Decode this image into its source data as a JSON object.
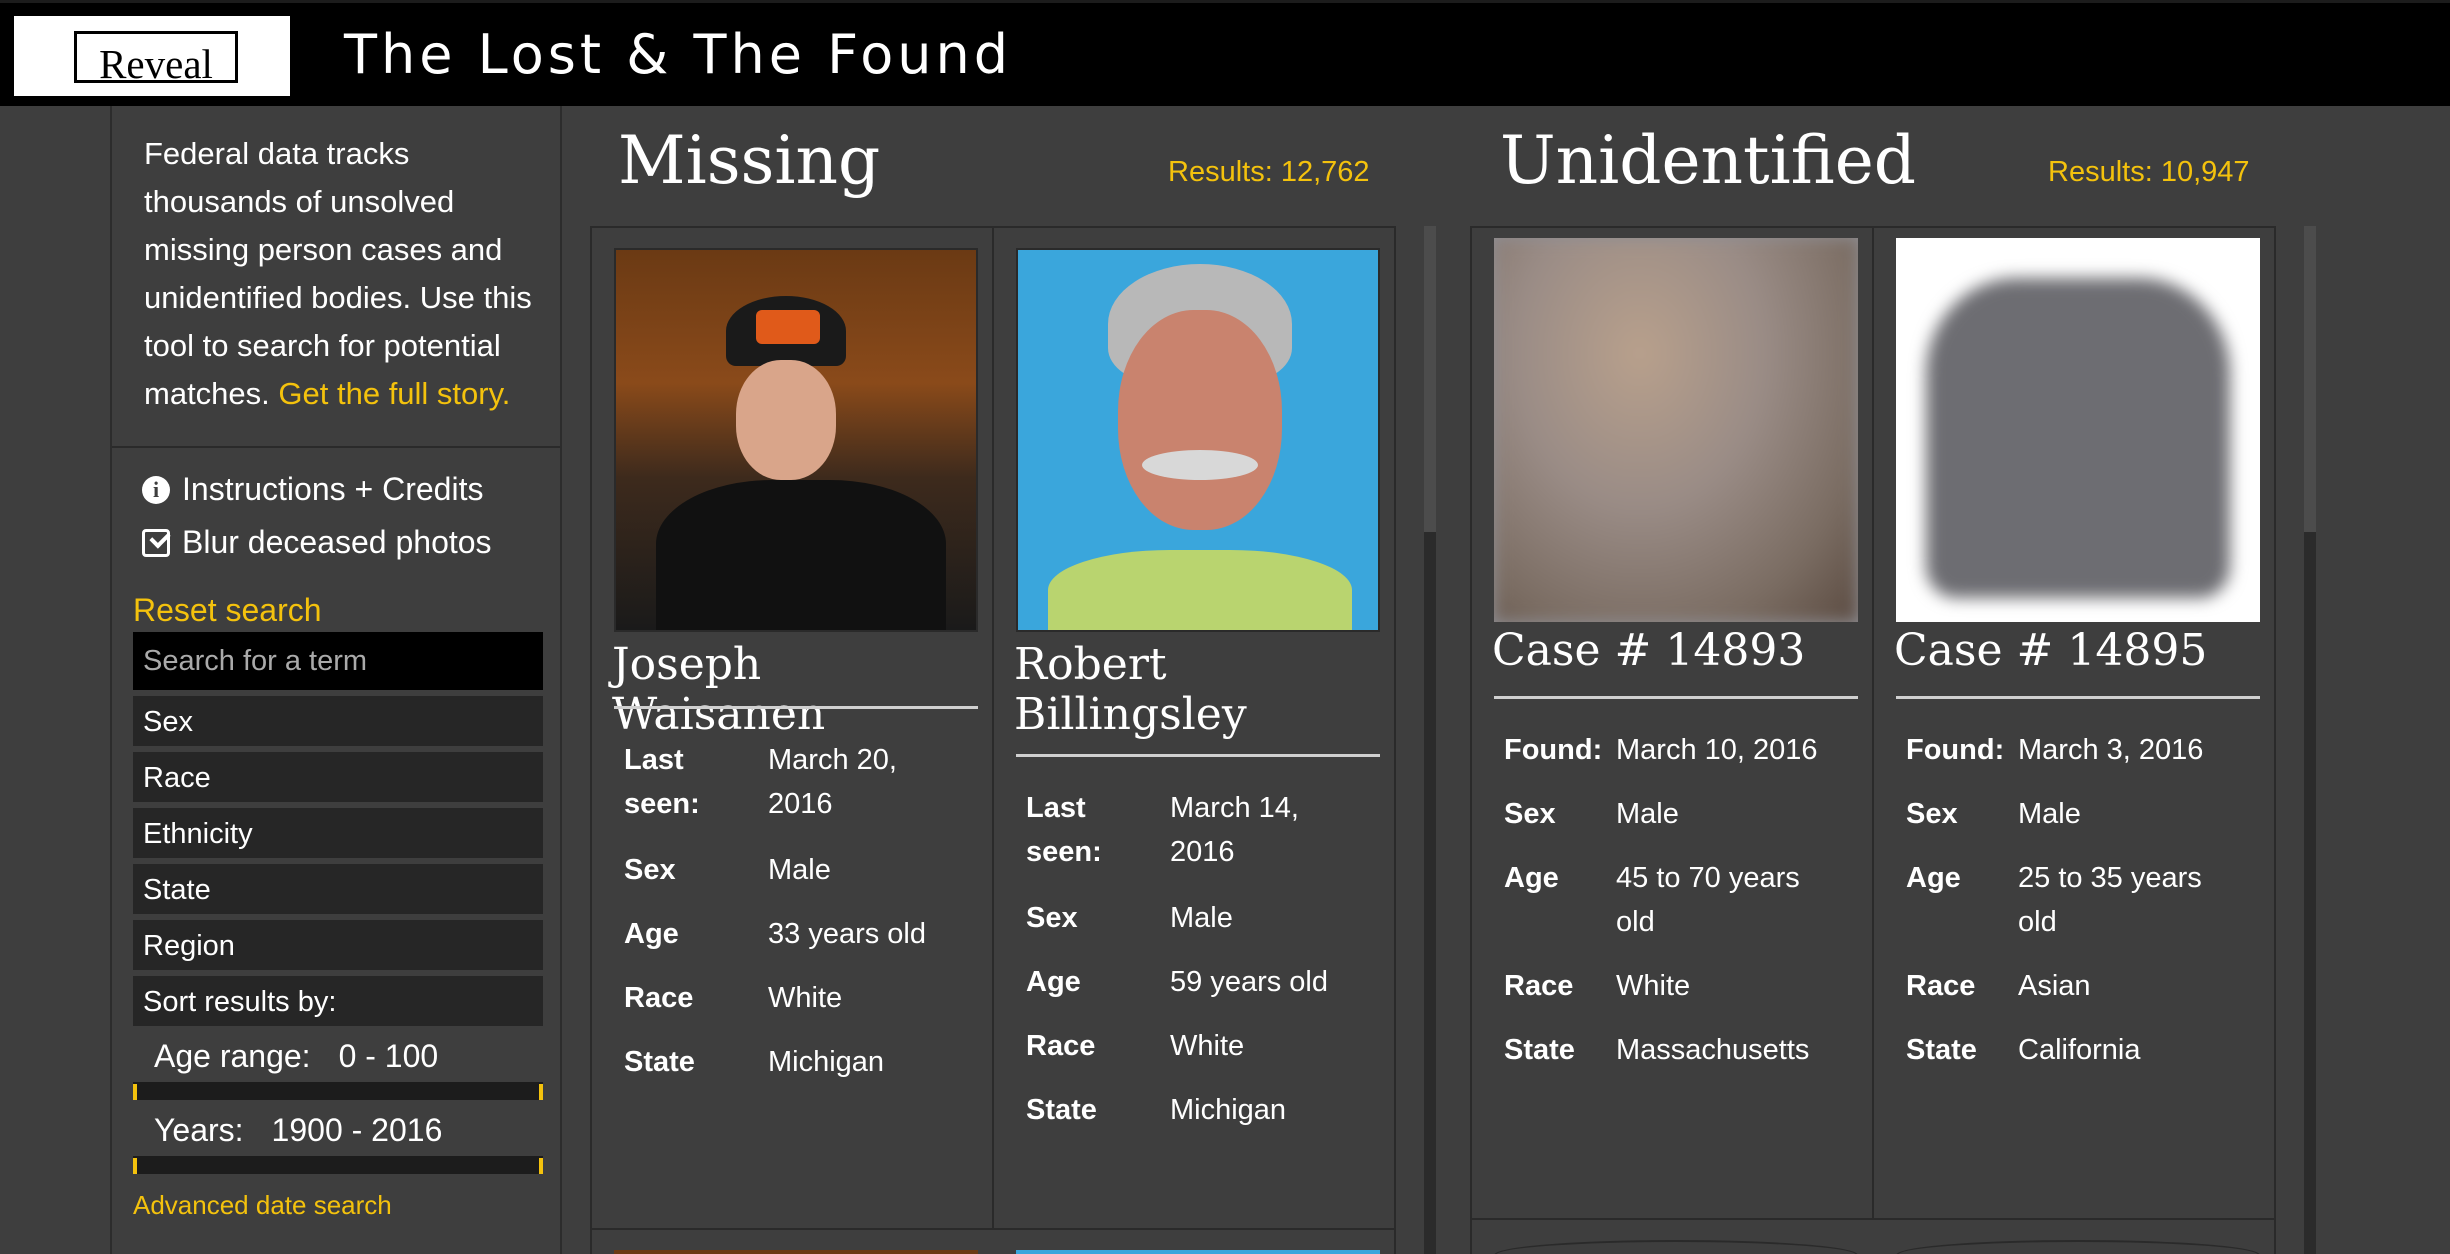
{
  "header": {
    "logo": "Reveal",
    "title": "The Lost & The Found"
  },
  "sidebar": {
    "intro": "Federal data tracks thousands of unsolved missing person cases and unidentified bodies. Use this tool to search for potential matches.",
    "story_link": "Get the full story.",
    "instructions": "Instructions + Credits",
    "blur": "Blur deceased photos",
    "reset": "Reset search",
    "search_placeholder": "Search for a term",
    "filters": [
      "Sex",
      "Race",
      "Ethnicity",
      "State",
      "Region",
      "Sort results by:"
    ],
    "age_range_label": "Age range:",
    "age_range_value": "0 - 100",
    "years_label": "Years:",
    "years_value": "1900 - 2016",
    "advanced": "Advanced date search"
  },
  "missing": {
    "title": "Missing",
    "results": "Results: 12,762",
    "cards": [
      {
        "name": "Joseph Waisanen",
        "fields": [
          {
            "label": "Last seen:",
            "value": "March 20, 2016"
          },
          {
            "label": "Sex",
            "value": "Male"
          },
          {
            "label": "Age",
            "value": "33 years old"
          },
          {
            "label": "Race",
            "value": "White"
          },
          {
            "label": "State",
            "value": "Michigan"
          }
        ]
      },
      {
        "name": "Robert Billingsley",
        "fields": [
          {
            "label": "Last seen:",
            "value": "March 14, 2016"
          },
          {
            "label": "Sex",
            "value": "Male"
          },
          {
            "label": "Age",
            "value": "59 years old"
          },
          {
            "label": "Race",
            "value": "White"
          },
          {
            "label": "State",
            "value": "Michigan"
          }
        ]
      }
    ]
  },
  "unidentified": {
    "title": "Unidentified",
    "results": "Results: 10,947",
    "cards": [
      {
        "name": "Case # 14893",
        "fields": [
          {
            "label": "Found:",
            "value": "March 10, 2016"
          },
          {
            "label": "Sex",
            "value": "Male"
          },
          {
            "label": "Age",
            "value": "45 to 70 years old"
          },
          {
            "label": "Race",
            "value": "White"
          },
          {
            "label": "State",
            "value": "Massachusetts"
          }
        ]
      },
      {
        "name": "Case # 14895",
        "fields": [
          {
            "label": "Found:",
            "value": "March 3, 2016"
          },
          {
            "label": "Sex",
            "value": "Male"
          },
          {
            "label": "Age",
            "value": "25 to 35 years old"
          },
          {
            "label": "Race",
            "value": "Asian"
          },
          {
            "label": "State",
            "value": "California"
          }
        ]
      }
    ]
  },
  "colors": {
    "accent": "#f4c20d",
    "background": "#3e3e3e",
    "header": "#000000"
  }
}
